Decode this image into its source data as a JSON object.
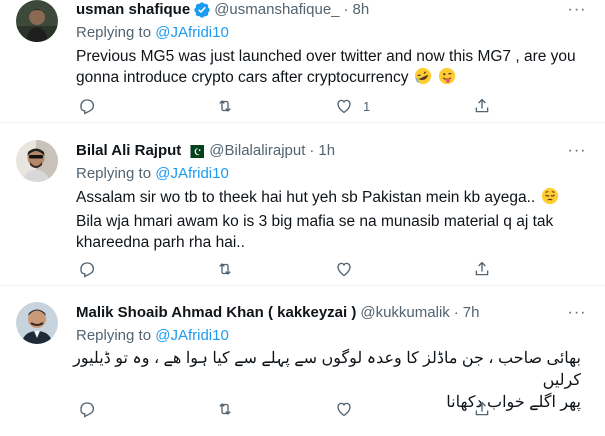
{
  "tweets": [
    {
      "name": "usman shafique",
      "verified": true,
      "handle": "@usmanshafique_",
      "dot": "·",
      "time": "8h",
      "replying_prefix": "Replying to",
      "replying_to": "@JAfridi10",
      "text": "Previous MG5 was just  launched over twitter and now this MG7 , are you gonna introduce crypto cars after cryptocurrency",
      "emojis": [
        "rolling-on-floor-laughing-emoji",
        "winking-tongue-emoji"
      ],
      "like_count": "1"
    },
    {
      "name": "Bilal Ali Rajput",
      "flag": "pakistan-flag-icon",
      "handle": "@Bilalalirajput",
      "dot": "·",
      "time": "1h",
      "replying_prefix": "Replying to",
      "replying_to": "@JAfridi10",
      "text_part1": "Assalam sir wo tb to theek hai hut yeh sb Pakistan mein kb ayega..",
      "emoji": "pensive-face-emoji",
      "text_part2": "Bila wja hmari awam ko is 3 big mafia se na munasib material q aj tak khareedna parh rha hai..",
      "like_count": ""
    },
    {
      "name": "Malik Shoaib Ahmad Khan ( kakkeyzai )",
      "handle": "@kukkumalik",
      "dot": "·",
      "time": "7h",
      "replying_prefix": "Replying to",
      "replying_to": "@JAfridi10",
      "text_line1": "بھائی صاحب ، جن ماڈلز کا وعدہ لوگوں  سے پہلے سے کیا ہوا ھے ، وہ تو ڈیلیور کرلیں",
      "text_line2": "پھر اگلے خواب دکھانا",
      "like_count": ""
    }
  ],
  "more_label": "···",
  "colors": {
    "link": "#1d9bf0",
    "secondary": "#536471",
    "primary": "#0f1419",
    "divider": "#eff3f4"
  }
}
